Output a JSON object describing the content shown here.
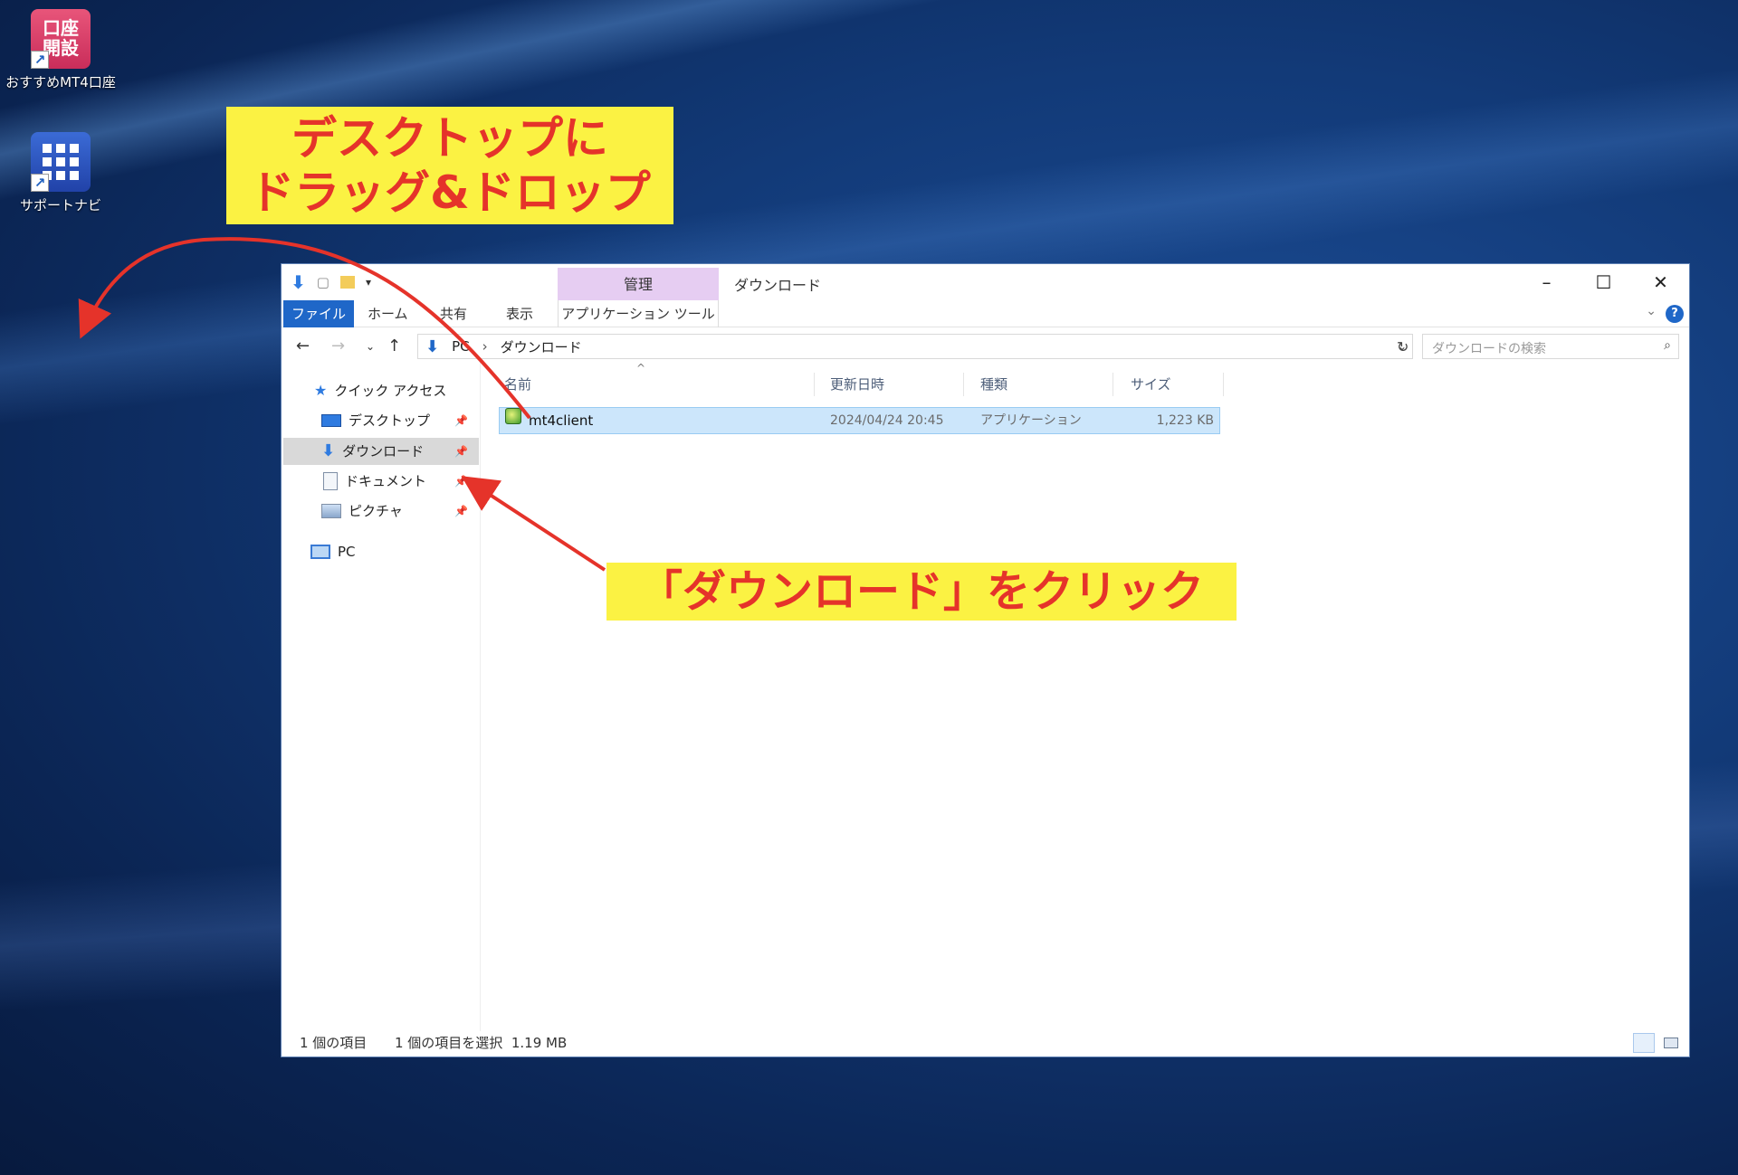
{
  "desktop": {
    "icons": [
      {
        "label": "おすすめMT4口座",
        "tile_text": "口座開設",
        "icon": "account-open-icon"
      },
      {
        "label": "サポートナビ",
        "icon": "grid-apps-icon"
      }
    ]
  },
  "annotations": {
    "drag_drop_line1": "デスクトップに",
    "drag_drop_line2": "ドラッグ&ドロップ",
    "click_downloads": "「ダウンロード」をクリック",
    "label_color": "#fbf243",
    "text_color": "#e5332a",
    "arrow_color": "#e5332a"
  },
  "window": {
    "title": "ダウンロード",
    "context_tab": "管理",
    "context_tab_color": "#e6cdf2",
    "ribbon_tabs": [
      "ファイル",
      "ホーム",
      "共有",
      "表示",
      "アプリケーション ツール"
    ],
    "file_tab_color": "#1f67c8",
    "breadcrumb": [
      "PC",
      "ダウンロード"
    ],
    "search_placeholder": "ダウンロードの検索",
    "sidebar": {
      "quick_access": "クイック アクセス",
      "items": [
        "デスクトップ",
        "ダウンロード",
        "ドキュメント",
        "ピクチャ"
      ],
      "selected": "ダウンロード",
      "pc": "PC"
    },
    "columns": [
      "名前",
      "更新日時",
      "種類",
      "サイズ"
    ],
    "files": [
      {
        "name": "mt4client",
        "modified": "2024/04/24 20:45",
        "type": "アプリケーション",
        "size": "1,223 KB"
      }
    ],
    "status": {
      "item_count": "1 個の項目",
      "selected": "1 個の項目を選択  1.19 MB"
    }
  }
}
